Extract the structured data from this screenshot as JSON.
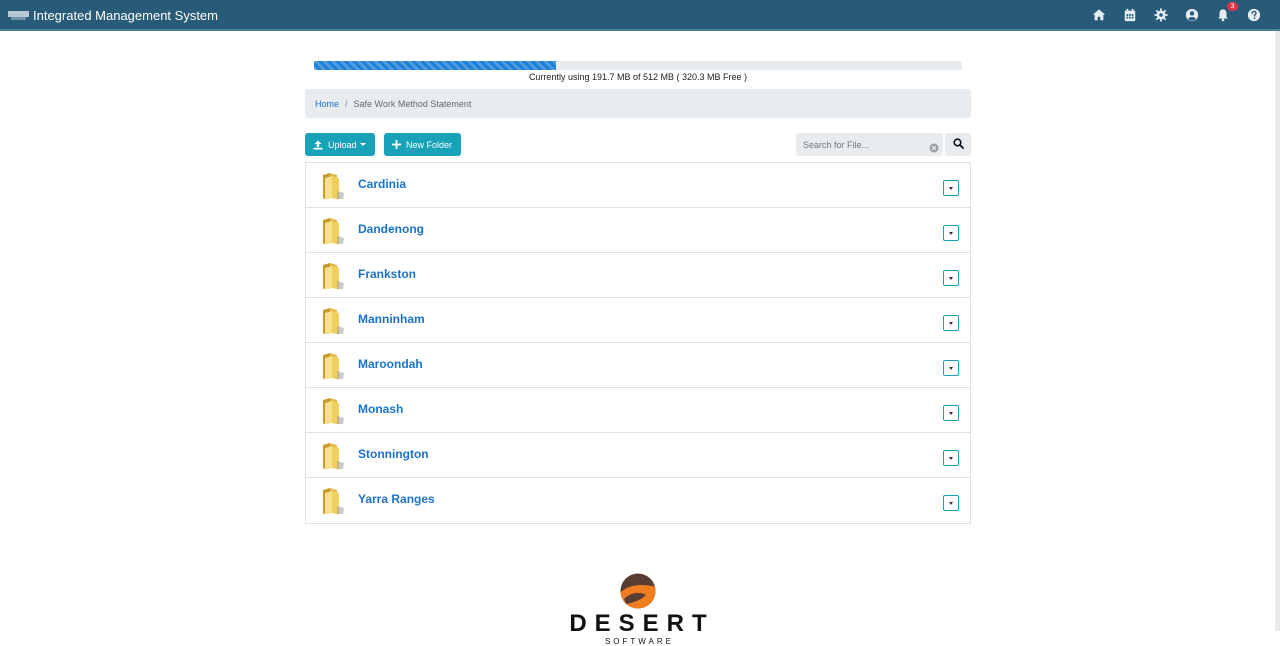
{
  "app": {
    "title": "Integrated Management System"
  },
  "nav": {
    "icons": [
      "home-icon",
      "calendar-icon",
      "gear-icon",
      "user-circle-icon",
      "bell-icon",
      "help-icon"
    ],
    "notification_count": "3"
  },
  "storage": {
    "used_fraction": 0.374,
    "text": "Currently using 191.7 MB of 512 MB ( 320.3 MB Free )"
  },
  "breadcrumb": {
    "home": "Home",
    "separator": "/",
    "current": "Safe Work Method Statement"
  },
  "toolbar": {
    "upload_label": "Upload",
    "new_folder_label": "New Folder",
    "search_placeholder": "Search for File..."
  },
  "folders": [
    {
      "name": "Cardinia"
    },
    {
      "name": "Dandenong"
    },
    {
      "name": "Frankston"
    },
    {
      "name": "Manninham"
    },
    {
      "name": "Maroondah"
    },
    {
      "name": "Monash"
    },
    {
      "name": "Stonnington"
    },
    {
      "name": "Yarra Ranges"
    }
  ],
  "footer": {
    "brand": "DESERT",
    "sub": "SOFTWARE"
  },
  "colors": {
    "topbar": "#275b78",
    "accent": "#17a2b8",
    "link": "#1a73c9",
    "progress": "#1e7fd6"
  }
}
